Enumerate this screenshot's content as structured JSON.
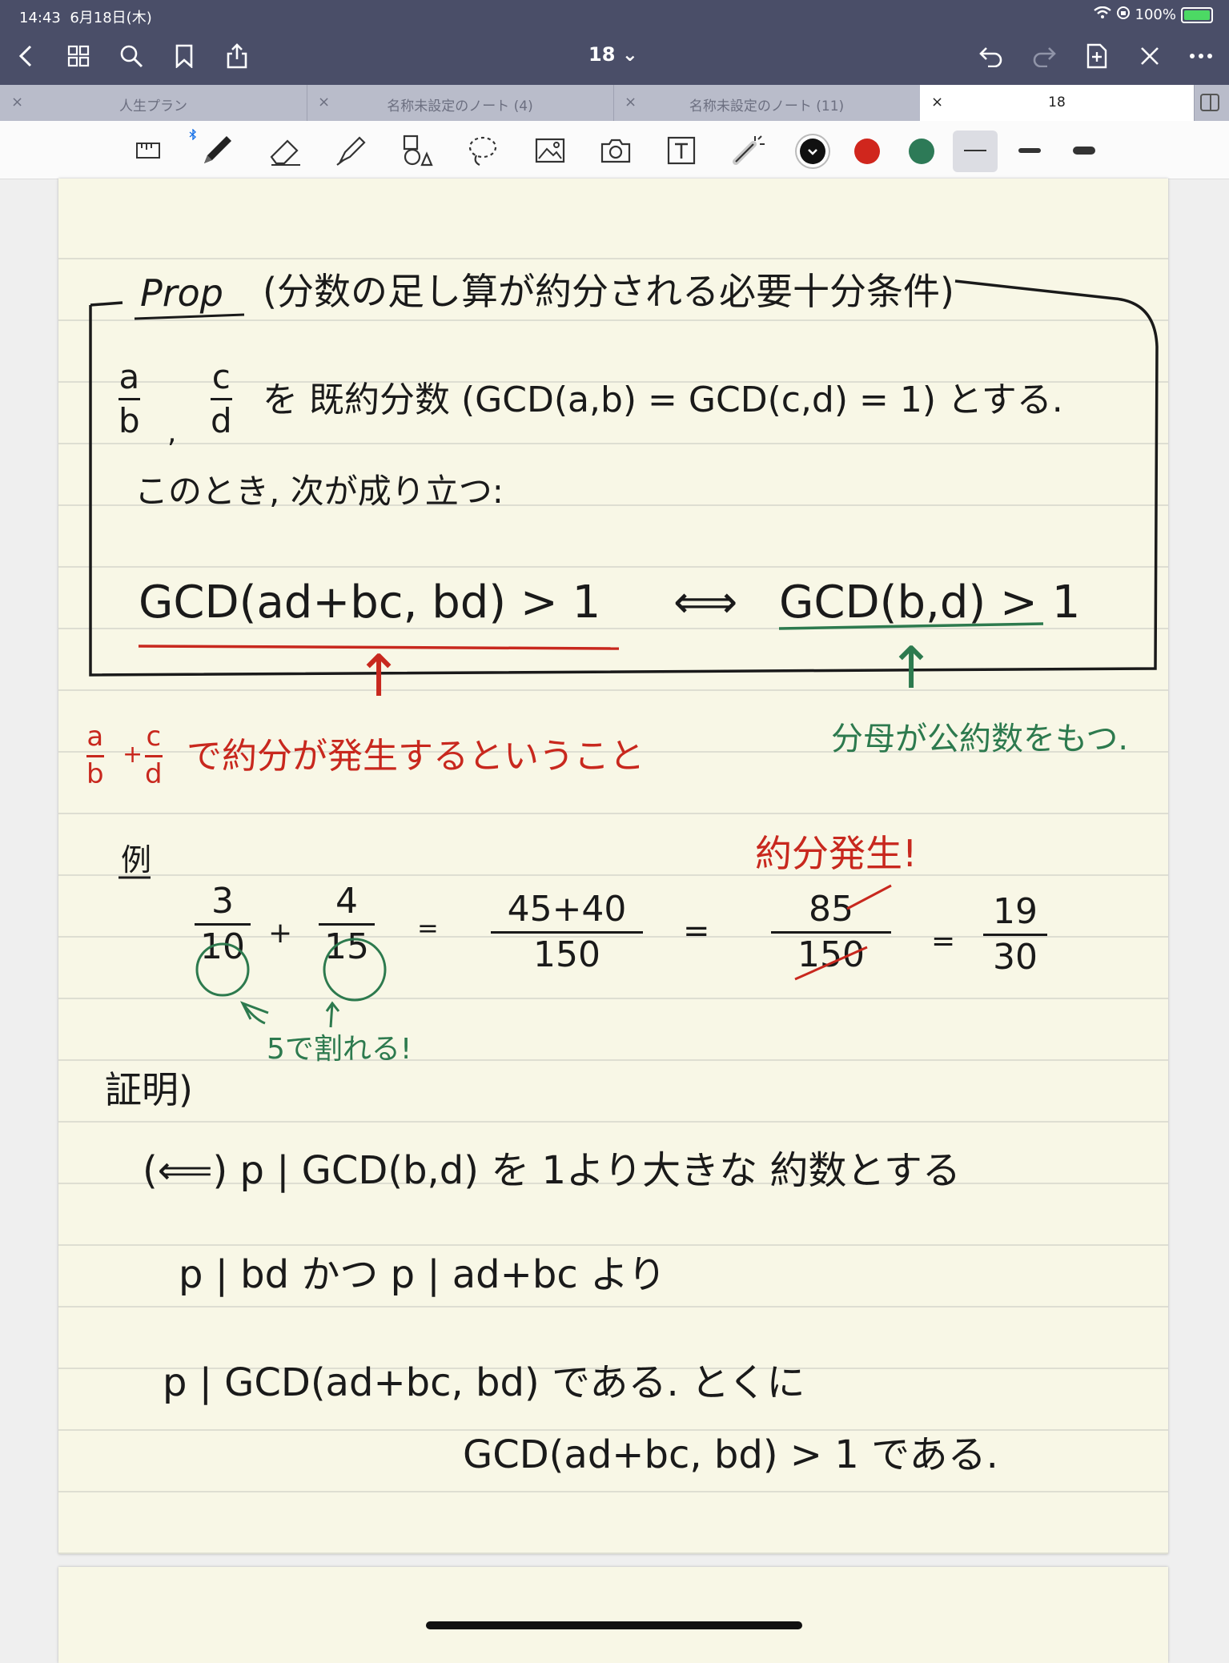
{
  "status": {
    "time": "14:43",
    "date": "6月18日(木)",
    "battery": "100%"
  },
  "nav": {
    "page_title": "18 ⌄"
  },
  "tabs": [
    {
      "label": "人生プラン"
    },
    {
      "label": "名称未設定のノート (4)"
    },
    {
      "label": "名称未設定のノート (11)"
    },
    {
      "label": "18"
    }
  ],
  "tab_close": "×",
  "toolbar": {
    "colors": [
      "#111111",
      "#d0261d",
      "#2d7a57"
    ]
  },
  "note": {
    "prop_label": "Prop",
    "prop_title": "(分数の足し算が約分される必要十分条件)",
    "frac1_num": "a",
    "frac1_den": "b",
    "comma": ",",
    "frac2_num": "c",
    "frac2_den": "d",
    "def_text": "を 既約分数 (GCD(a,b) = GCD(c,d) = 1) とする.",
    "then_text": "このとき, 次が成り立つ:",
    "lhs": "GCD(ad+bc, bd) > 1",
    "iff": "⟺",
    "rhs": "GCD(b,d) > 1",
    "arrow_up": "↑",
    "red_frac1_num": "a",
    "red_frac1_den": "b",
    "red_plus": "+",
    "red_frac2_num": "c",
    "red_frac2_den": "d",
    "red_note": "で約分が発生するということ",
    "green_note": "分母が公約数をもつ.",
    "example_label": "例",
    "ex_n1": "3",
    "ex_d1": "10",
    "ex_plus": "+",
    "ex_n2": "4",
    "ex_d2": "15",
    "ex_eq": "=",
    "ex_n3": "45+40",
    "ex_d3": "150",
    "ex_n4": "85",
    "ex_d4": "150",
    "ex_n5": "19",
    "ex_d5": "30",
    "reduction_note": "約分発生!",
    "divisible_note": "5で割れる!",
    "proof_label": "証明)",
    "proof_line1": "(⟸)  p | GCD(b,d) を 1より大きな 約数とする",
    "proof_line2": "p | bd  かつ  p | ad+bc  より",
    "proof_line3": "p | GCD(ad+bc, bd) である. とくに",
    "proof_line4": "GCD(ad+bc, bd) > 1 である."
  }
}
